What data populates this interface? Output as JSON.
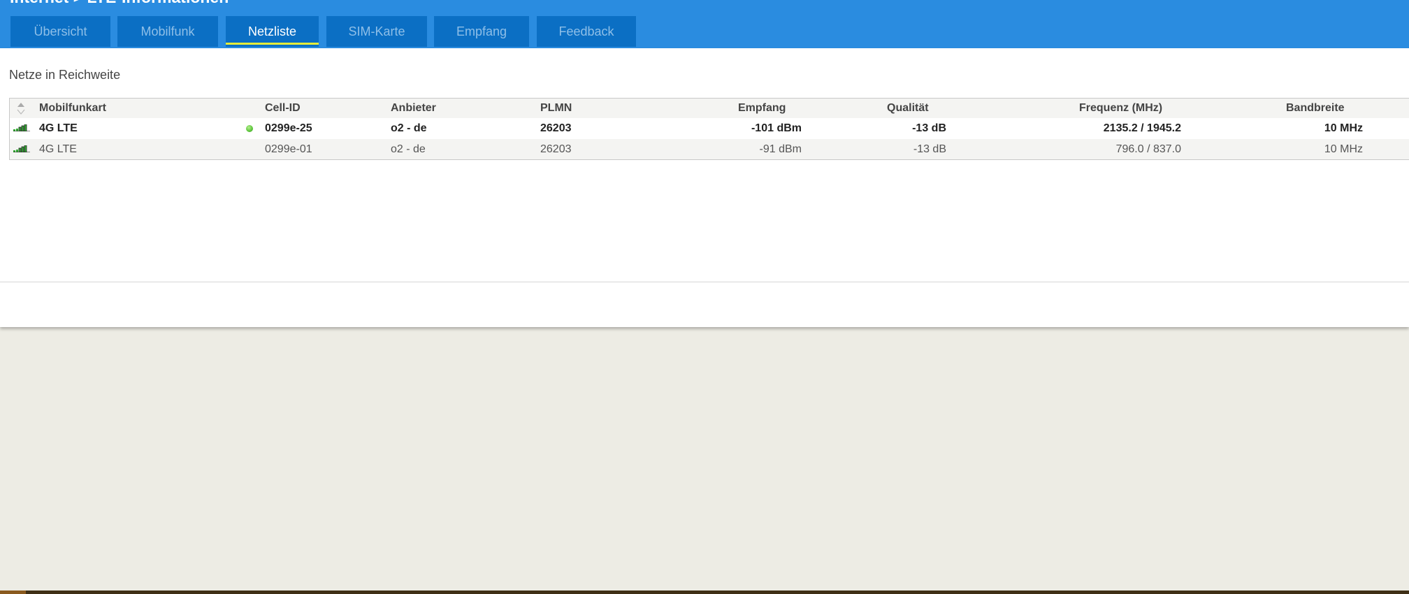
{
  "header": {
    "title": "Internet > LTE-Informationen"
  },
  "tabs": [
    {
      "label": "Übersicht",
      "active": false
    },
    {
      "label": "Mobilfunk",
      "active": false
    },
    {
      "label": "Netzliste",
      "active": true
    },
    {
      "label": "SIM-Karte",
      "active": false
    },
    {
      "label": "Empfang",
      "active": false
    },
    {
      "label": "Feedback",
      "active": false
    }
  ],
  "section_title": "Netze in Reichweite",
  "table": {
    "columns": [
      "Mobilfunkart",
      "Cell-ID",
      "Anbieter",
      "PLMN",
      "Empfang",
      "Qualität",
      "Frequenz (MHz)",
      "Bandbreite"
    ],
    "rows": [
      {
        "type": "4G LTE",
        "active": true,
        "cell_id": "0299e-25",
        "provider": "o2 - de",
        "plmn": "26203",
        "reception": "-101 dBm",
        "quality": "-13 dB",
        "frequency": "2135.2 / 1945.2",
        "bandwidth": "10 MHz"
      },
      {
        "type": "4G LTE",
        "active": false,
        "cell_id": "0299e-01",
        "provider": "o2 - de",
        "plmn": "26203",
        "reception": "-91 dBm",
        "quality": "-13 dB",
        "frequency": "796.0 / 837.0",
        "bandwidth": "10 MHz"
      }
    ]
  },
  "colors": {
    "header": "#2a8ce0",
    "tab": "#0b6fc4",
    "active_underline": "#e5ec3a",
    "active_dot": "#5ac33a"
  }
}
